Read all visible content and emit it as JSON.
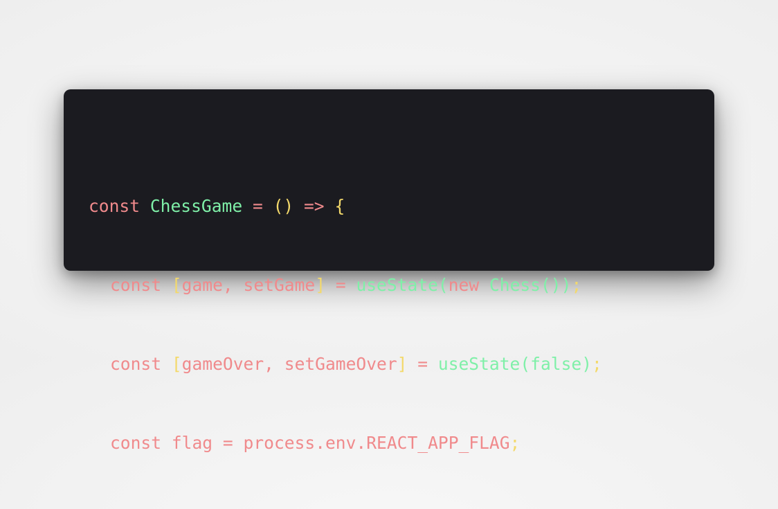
{
  "colors": {
    "background": "#f2f2f2",
    "card": "#1b1b20",
    "keyword": "#f08a8c",
    "function": "#7ff0a8",
    "bracket": "#f3d96b"
  },
  "code": {
    "line1": {
      "kw": "const",
      "name": "ChessGame",
      "eq": "=",
      "paren": "()",
      "arrow": "=>",
      "brace": "{"
    },
    "line2": {
      "kw": "const",
      "open": "[",
      "a": "game",
      "comma": ",",
      "b": "setGame",
      "close": "]",
      "eq": "=",
      "fn": "useState",
      "p1": "(",
      "newkw": "new",
      "cls": "Chess",
      "p2": "()",
      "p3": ")",
      "semi": ";"
    },
    "line3": {
      "kw": "const",
      "open": "[",
      "a": "gameOver",
      "comma": ",",
      "b": "setGameOver",
      "close": "]",
      "eq": "=",
      "fn": "useState",
      "p1": "(",
      "val": "false",
      "p2": ")",
      "semi": ";"
    },
    "line4": {
      "kw": "const",
      "name": "flag",
      "eq": "=",
      "obj": "process",
      "dot1": ".",
      "env": "env",
      "dot2": ".",
      "prop": "REACT_APP_FLAG",
      "semi": ";"
    }
  }
}
